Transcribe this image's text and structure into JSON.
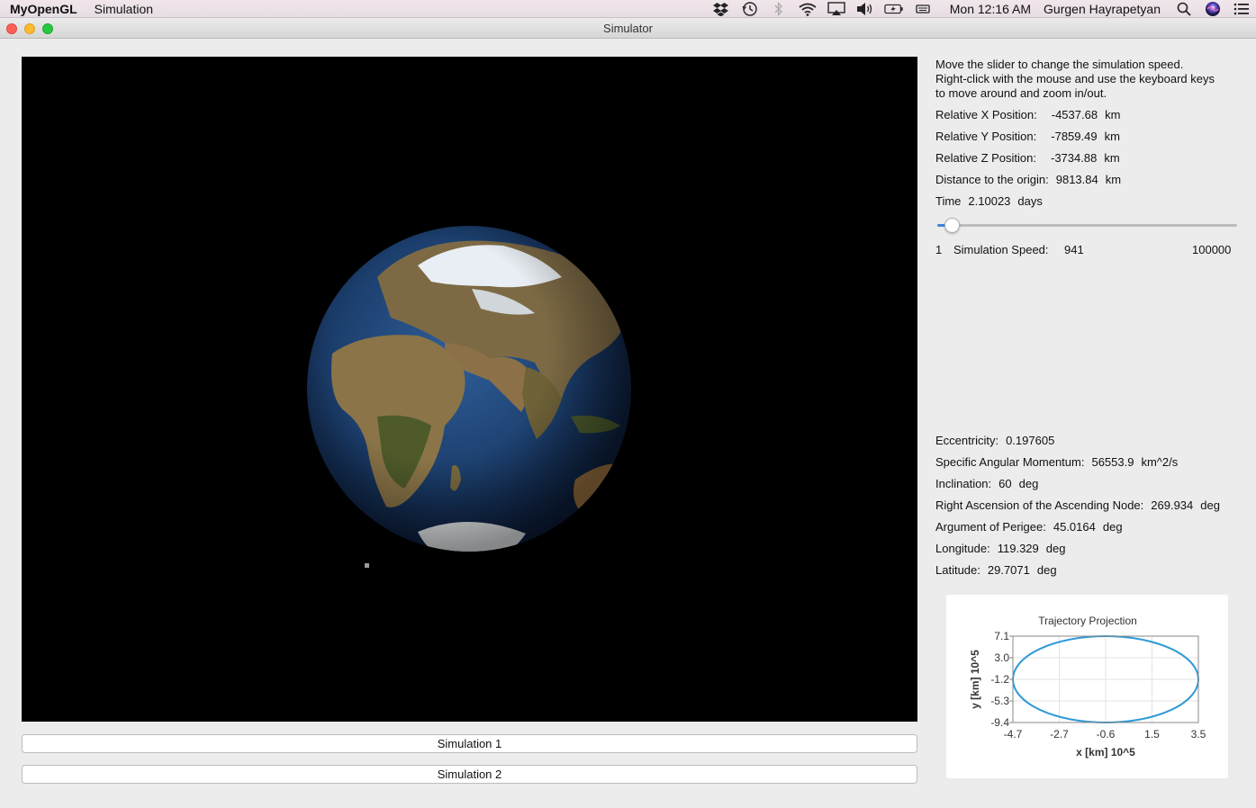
{
  "menubar": {
    "app_name": "MyOpenGL",
    "menus": [
      "Simulation"
    ],
    "status_icons": [
      "dropbox-icon",
      "time-machine-icon",
      "bluetooth-icon",
      "wifi-icon",
      "airplay-icon",
      "volume-icon",
      "battery-icon",
      "keyboard-icon"
    ],
    "clock": "Mon 12:16 AM",
    "user": "Gurgen Hayrapetyan"
  },
  "window": {
    "title": "Simulator"
  },
  "buttons": {
    "sim1": "Simulation 1",
    "sim2": "Simulation 2"
  },
  "info": {
    "help_lines": [
      "Move the slider to change the simulation speed.",
      "Right-click with the mouse and use the keyboard keys",
      "to move around and zoom in/out."
    ],
    "x_label": "Relative X Position:",
    "x_value": "-4537.68",
    "x_unit": "km",
    "y_label": "Relative Y Position:",
    "y_value": "-7859.49",
    "y_unit": "km",
    "z_label": "Relative Z Position:",
    "z_value": "-3734.88",
    "z_unit": "km",
    "dist_label": "Distance to the origin:",
    "dist_value": "9813.84",
    "dist_unit": "km",
    "time_label": "Time",
    "time_value": "2.10023",
    "time_unit": "days"
  },
  "speed": {
    "min_label": "1",
    "label": "Simulation Speed:",
    "value": "941",
    "max_label": "100000",
    "value_num": 941,
    "min_num": 1,
    "max_num": 100000
  },
  "orbit": {
    "ecc_label": "Eccentricity:",
    "ecc_value": "0.197605",
    "h_label": "Specific Angular Momentum:",
    "h_value": "56553.9",
    "h_unit": "km^2/s",
    "inc_label": "Inclination:",
    "inc_value": "60",
    "inc_unit": "deg",
    "raan_label": "Right Ascension of the Ascending Node:",
    "raan_value": "269.934",
    "raan_unit": "deg",
    "argp_label": "Argument of Perigee:",
    "argp_value": "45.0164",
    "argp_unit": "deg",
    "lon_label": "Longitude:",
    "lon_value": "119.329",
    "lon_unit": "deg",
    "lat_label": "Latitude:",
    "lat_value": "29.7071",
    "lat_unit": "deg"
  },
  "chart_data": {
    "type": "line",
    "title": "Trajectory Projection",
    "xlabel": "x [km] 10^5",
    "ylabel": "y [km] 10^5",
    "x_ticks": [
      "-4.7",
      "-2.7",
      "-0.6",
      "1.5",
      "3.5"
    ],
    "y_ticks": [
      "7.1",
      "3.0",
      "-1.2",
      "-5.3",
      "-9.4"
    ],
    "xlim": [
      -4.7,
      3.5
    ],
    "ylim": [
      -9.4,
      7.1
    ],
    "grid": true,
    "series": [
      {
        "shape": "ellipse",
        "center_x": -0.6,
        "center_y": -1.15,
        "semi_x": 4.1,
        "semi_y": 8.25,
        "color": "#2f9ad8"
      }
    ]
  }
}
